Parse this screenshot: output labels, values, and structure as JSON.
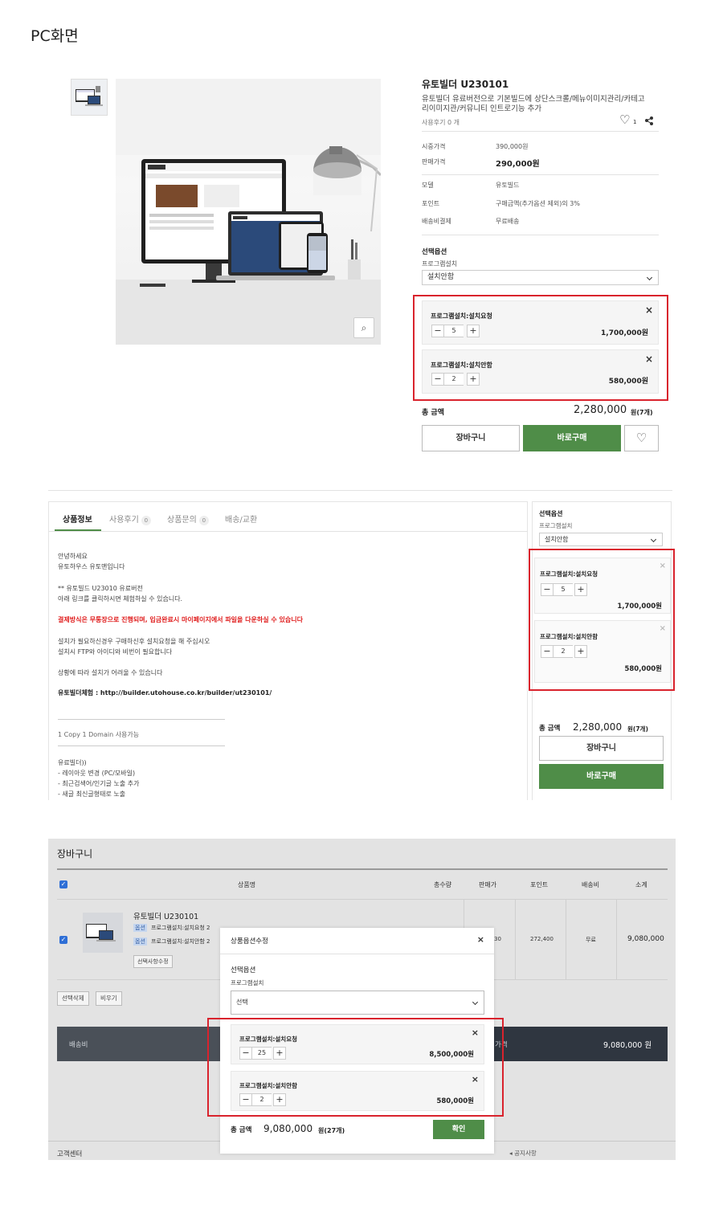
{
  "header": {
    "title": "PC화면"
  },
  "product": {
    "title": "유토빌더 U230101",
    "description_line1": "유토빌더 유료버전으로 기본빌드에 상단스크롤/메뉴이미지관리/카테고",
    "description_line2": "리이미지관/커뮤니티 인트로기능 추가",
    "review_label": "사용후기 0 개",
    "like_count": "1",
    "info_rows": [
      {
        "label": "시중가격",
        "value": "390,000원"
      },
      {
        "label": "판매가격",
        "value": "290,000원"
      },
      {
        "label": "모델",
        "value": "유토빌드"
      },
      {
        "label": "포인트",
        "value": "구매금액(추가옵션 제외)의 3%"
      },
      {
        "label": "배송비결제",
        "value": "무료배송"
      }
    ],
    "option_title": "선택옵션",
    "option_label": "프로그램설치",
    "option_selected": "설치안함",
    "options": [
      {
        "name": "프로그램설치:설치요청",
        "qty": "5",
        "price": "1,700,000원"
      },
      {
        "name": "프로그램설치:설치안함",
        "qty": "2",
        "price": "580,000원"
      }
    ],
    "total_label": "총 금액",
    "total_value": "2,280,000",
    "total_unit": "원(7개)",
    "cart_button": "장바구니",
    "buy_button": "바로구매",
    "minus": "−",
    "plus": "+",
    "close": "×"
  },
  "tabs": [
    {
      "label": "상품정보"
    },
    {
      "label": "사용후기",
      "count": "0"
    },
    {
      "label": "상품문의",
      "count": "0"
    },
    {
      "label": "배송/교환"
    }
  ],
  "content": {
    "lines": [
      "안녕하세요",
      "유토하우스 유토맨입니다",
      "** 유토빌드 U23010 유료버전",
      "아래 링크를 클릭하시면 체험하실 수 있습니다.",
      "결제방식은 무통장으로 진행되며, 입금완료시 마이페이지에서 파일을 다운하실 수 있습니다",
      "설치가 필요하신경우 구매하신후 설치요청을 해 주십시오",
      "설치시 FTP와 아이디와 비번이 필요합니다",
      "상황에 따라 설치가 어려울 수 있습니다",
      "유토빌더체험 : http://builder.utohouse.co.kr/builder/ut230101/",
      "1 Copy 1 Domain 사용가능",
      "유료빌더))",
      "- 레이아웃 변경 (PC/모바일)",
      "- 최근검색어/인기글 노출 추가",
      "- 새글 최신글형태로 노출"
    ]
  },
  "side": {
    "option_title": "선택옵션",
    "option_label": "프로그램설치",
    "option_selected": "설치안함",
    "total_label": "총 금액",
    "total_value": "2,280,000",
    "total_unit": "원(7개)",
    "cart_button": "장바구니",
    "buy_button": "바로구매"
  },
  "cart": {
    "title": "장바구니",
    "headers": [
      "상품명",
      "총수량",
      "판매가",
      "포인트",
      "배송비",
      "소계"
    ],
    "item_name": "유토빌더 U230101",
    "opt_badge": "옵션",
    "opt1": "프로그램설치:설치요청 2",
    "opt2": "프로그램설치:설치안함 2",
    "opt_edit": "선택사항수정",
    "price_fragment": "30",
    "point": "272,400",
    "shipping": "무료",
    "subtotal": "9,080,000",
    "delete_selected": "선택삭제",
    "empty": "비우기",
    "shipping_label": "배송비",
    "total_fragment": "가격",
    "total_value": "9,080,000 원",
    "footer_left": "고객센터",
    "footer_right": "◂ 공지사항"
  },
  "modal": {
    "title": "상품옵션수정",
    "option_title": "선택옵션",
    "option_label": "프로그램설치",
    "select_value": "선택",
    "options": [
      {
        "name": "프로그램설치:설치요청",
        "qty": "25",
        "price": "8,500,000원"
      },
      {
        "name": "프로그램설치:설치안함",
        "qty": "2",
        "price": "580,000원"
      }
    ],
    "total_label": "총 금액",
    "total_value": "9,080,000",
    "total_unit": "원(27개)",
    "confirm": "확인"
  }
}
